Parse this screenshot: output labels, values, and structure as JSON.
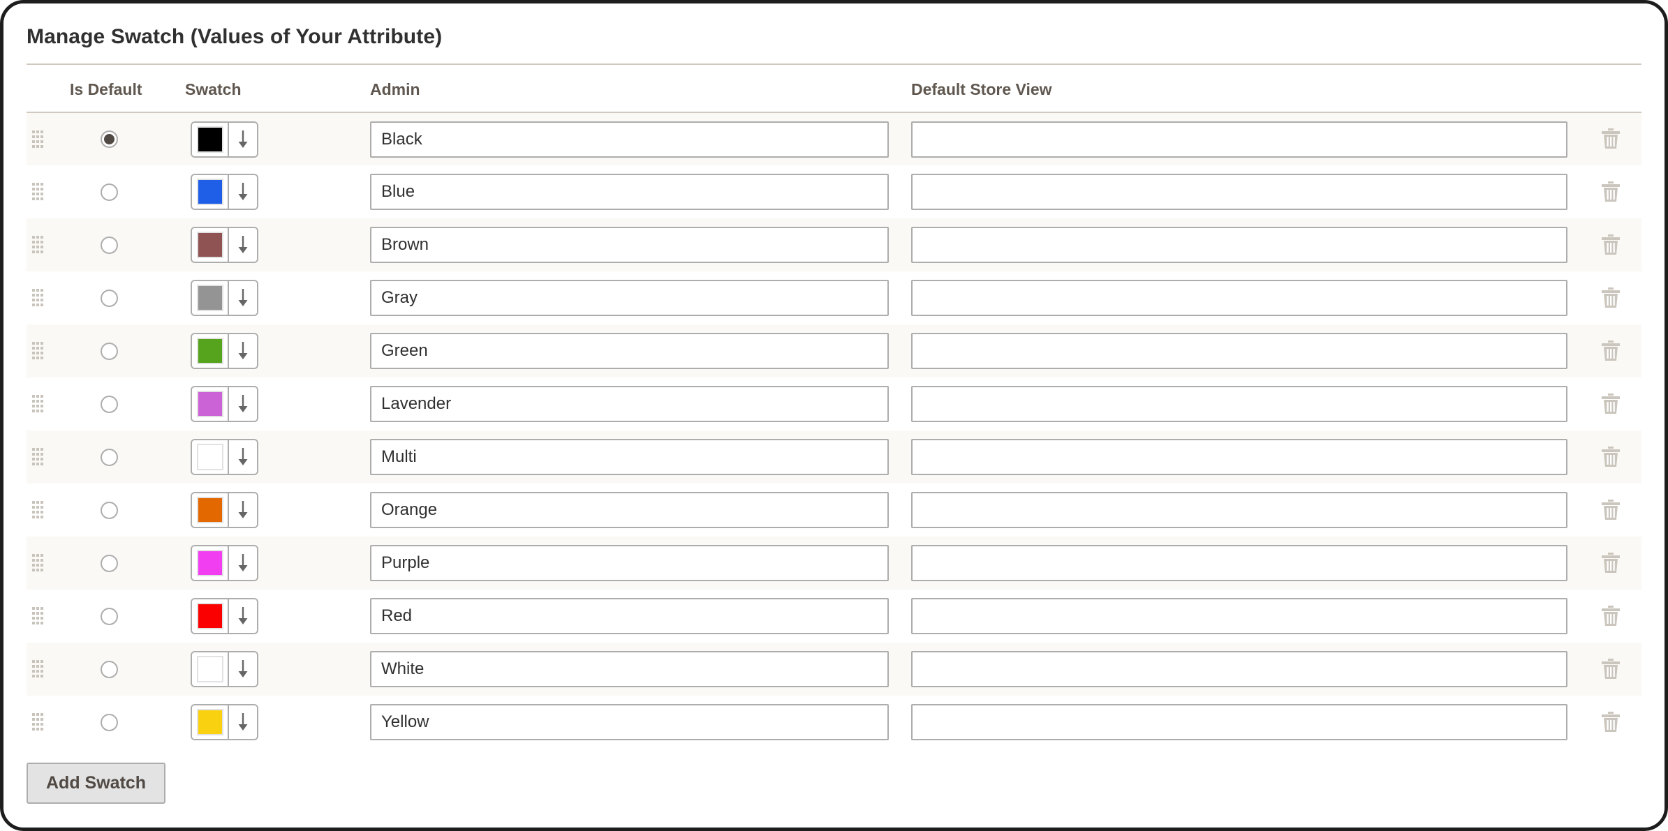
{
  "window": {
    "panel_title": "Manage Swatch (Values of Your Attribute)"
  },
  "table": {
    "headers": {
      "handle": "",
      "is_default": "Is Default",
      "swatch": "Swatch",
      "admin": "Admin",
      "default_store_view": "Default Store View",
      "delete": ""
    },
    "icons": {
      "drag_handle": "drag-handle-icon",
      "swatch_dropdown_arrow": "arrow-down-icon",
      "delete": "trash-icon"
    },
    "rows": [
      {
        "is_default": true,
        "swatch_color": "#000000",
        "swatch_empty": false,
        "admin": "Black",
        "store_view": ""
      },
      {
        "is_default": false,
        "swatch_color": "#1f5fe8",
        "swatch_empty": false,
        "admin": "Blue",
        "store_view": ""
      },
      {
        "is_default": false,
        "swatch_color": "#8f5353",
        "swatch_empty": false,
        "admin": "Brown",
        "store_view": ""
      },
      {
        "is_default": false,
        "swatch_color": "#949494",
        "swatch_empty": false,
        "admin": "Gray",
        "store_view": ""
      },
      {
        "is_default": false,
        "swatch_color": "#56a41d",
        "swatch_empty": false,
        "admin": "Green",
        "store_view": ""
      },
      {
        "is_default": false,
        "swatch_color": "#cb63d6",
        "swatch_empty": false,
        "admin": "Lavender",
        "store_view": ""
      },
      {
        "is_default": false,
        "swatch_color": "#ffffff",
        "swatch_empty": true,
        "admin": "Multi",
        "store_view": ""
      },
      {
        "is_default": false,
        "swatch_color": "#e36800",
        "swatch_empty": false,
        "admin": "Orange",
        "store_view": ""
      },
      {
        "is_default": false,
        "swatch_color": "#f13ef1",
        "swatch_empty": false,
        "admin": "Purple",
        "store_view": ""
      },
      {
        "is_default": false,
        "swatch_color": "#fa0000",
        "swatch_empty": false,
        "admin": "Red",
        "store_view": ""
      },
      {
        "is_default": false,
        "swatch_color": "#ffffff",
        "swatch_empty": true,
        "admin": "White",
        "store_view": ""
      },
      {
        "is_default": false,
        "swatch_color": "#fad110",
        "swatch_empty": false,
        "admin": "Yellow",
        "store_view": ""
      }
    ]
  },
  "actions": {
    "add_swatch_label": "Add Swatch"
  },
  "theme": {
    "title_color": "#303030",
    "header_text_color": "#5f574f",
    "rule_color": "#d1c9bf",
    "stripe_color": "#faf9f5",
    "input_border": "#adadad",
    "radio_checked_color": "#514943",
    "icon_gray": "#c9c4bb",
    "button_bg": "#e3e3e3"
  }
}
